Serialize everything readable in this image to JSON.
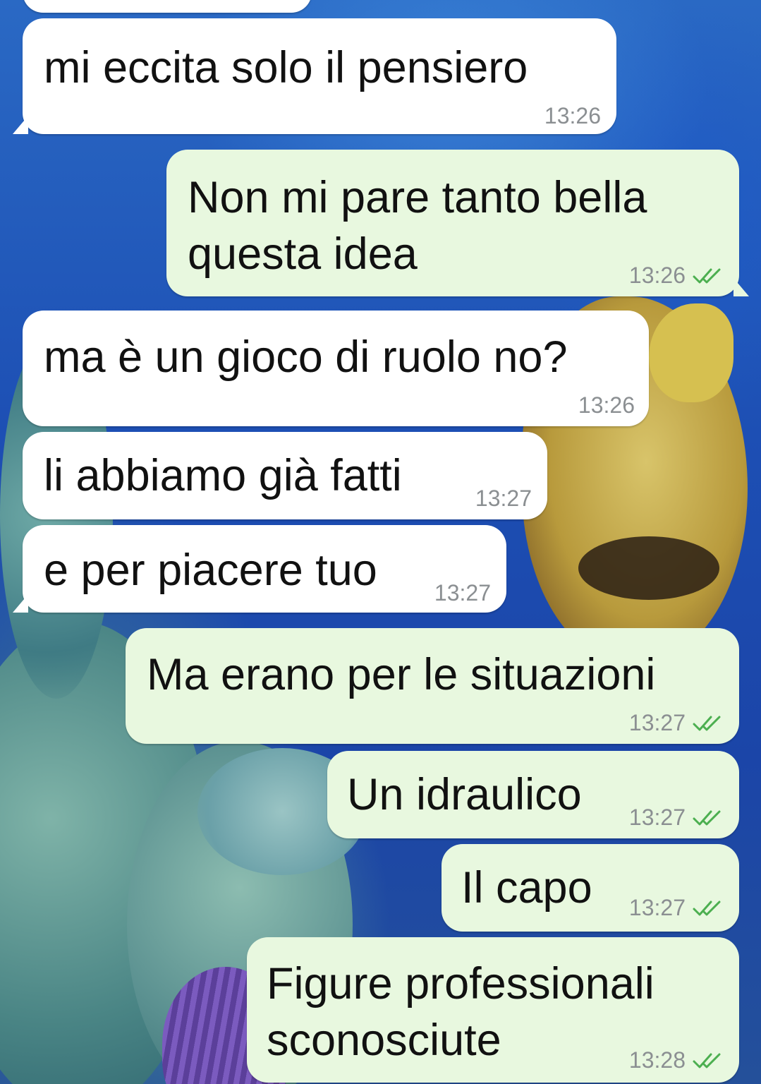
{
  "messages": [
    {
      "direction": "in",
      "text": "mi eccita solo il pensiero",
      "time": "13:26"
    },
    {
      "direction": "out",
      "text": "Non mi pare tanto bella\nquesta idea",
      "time": "13:26",
      "read": true
    },
    {
      "direction": "in",
      "text": "ma è un gioco di ruolo no?",
      "time": "13:26"
    },
    {
      "direction": "in",
      "text": "li abbiamo già fatti",
      "time": "13:27"
    },
    {
      "direction": "in",
      "text": "e per piacere tuo",
      "time": "13:27"
    },
    {
      "direction": "out",
      "text": "Ma erano per le situazioni",
      "time": "13:27",
      "read": true
    },
    {
      "direction": "out",
      "text": "Un idraulico",
      "time": "13:27",
      "read": true
    },
    {
      "direction": "out",
      "text": "Il capo",
      "time": "13:27",
      "read": true
    },
    {
      "direction": "out",
      "text": "Figure professionali\nsconosciute",
      "time": "13:28",
      "read": true
    }
  ],
  "icons": {
    "read_receipt": "double-check-icon"
  },
  "colors": {
    "incoming_bubble": "#ffffff",
    "outgoing_bubble": "#e8f8df",
    "timestamp": "#8b8f92",
    "read_ticks": "#4fc3f7"
  }
}
